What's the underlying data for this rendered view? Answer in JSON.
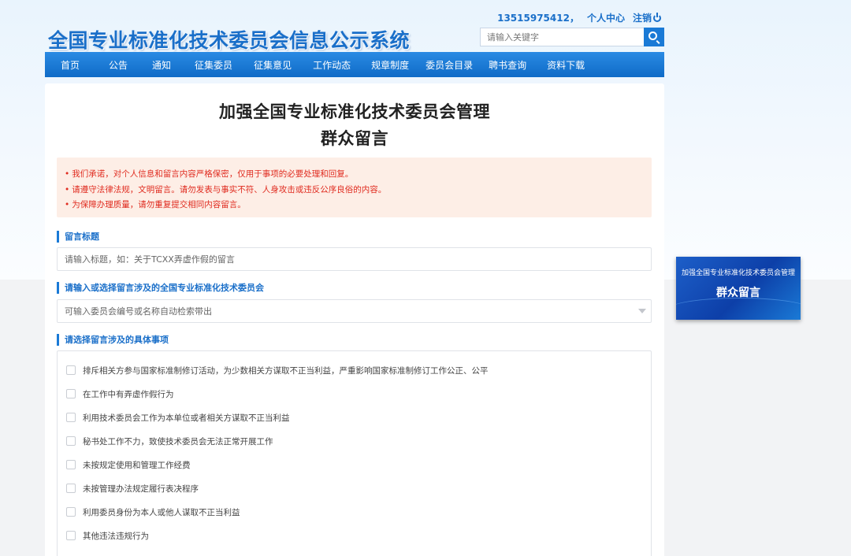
{
  "header": {
    "site_title": "全国专业标准化技术委员会信息公示系统",
    "user_phone": "13515975412，",
    "personal_center": "个人中心",
    "logout": "注销",
    "search_placeholder": "请输入关键字"
  },
  "nav": {
    "items": [
      "首页",
      "公告",
      "通知",
      "征集委员",
      "征集意见",
      "工作动态",
      "规章制度",
      "委员会目录",
      "聘书查询",
      "资料下载"
    ]
  },
  "form": {
    "title_line1": "加强全国专业标准化技术委员会管理",
    "title_line2": "群众留言",
    "notices": [
      "我们承诺，对个人信息和留言内容严格保密，仅用于事项的必要处理和回复。",
      "请遵守法律法规，文明留言。请勿发表与事实不符、人身攻击或违反公序良俗的内容。",
      "为保障办理质量，请勿重复提交相同内容留言。"
    ],
    "title_section": {
      "label": "留言标题",
      "placeholder": "请输入标题，如：关于TCXX弄虚作假的留言"
    },
    "committee_section": {
      "label": "请输入或选择留言涉及的全国专业标准化技术委员会",
      "placeholder": "可输入委员会编号或名称自动检索带出"
    },
    "matters_section": {
      "label": "请选择留言涉及的具体事项",
      "options": [
        "排斥相关方参与国家标准制修订活动，为少数相关方谋取不正当利益，严重影响国家标准制修订工作公正、公平",
        "在工作中有弄虚作假行为",
        "利用技术委员会工作为本单位或者相关方谋取不正当利益",
        "秘书处工作不力，致使技术委员会无法正常开展工作",
        "未按规定使用和管理工作经费",
        "未按管理办法规定履行表决程序",
        "利用委员身份为本人或他人谋取不正当利益",
        "其他违法违规行为"
      ]
    }
  },
  "side_banner": {
    "line1": "加强全国专业标准化技术委员会管理",
    "line2": "群众留言"
  },
  "colors": {
    "brand_blue": "#1a6fc9",
    "nav_blue": "#0f6bc7",
    "notice_bg": "#fdeee6",
    "notice_text": "#e02b1f"
  }
}
